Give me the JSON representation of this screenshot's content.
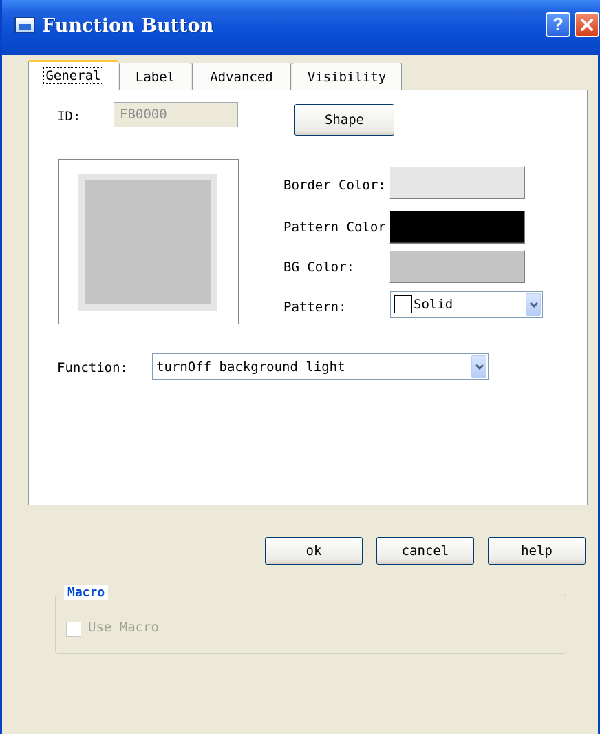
{
  "window": {
    "title": "Function Button",
    "help_label": "?",
    "close_label": "✕",
    "titlebar_color": "#0A4FD6"
  },
  "tabs": [
    {
      "label": "General",
      "active": true
    },
    {
      "label": "Label",
      "active": false
    },
    {
      "label": "Advanced",
      "active": false
    },
    {
      "label": "Visibility",
      "active": false
    }
  ],
  "general": {
    "id_label": "ID:",
    "id_value": "FB0000",
    "shape_button": "Shape",
    "border_color_label": "Border Color:",
    "border_color_value": "#E6E6E6",
    "pattern_color_label": "Pattern Color",
    "pattern_color_value": "#000000",
    "bg_color_label": "BG Color:",
    "bg_color_value": "#C4C4C4",
    "pattern_label": "Pattern:",
    "pattern_value": "Solid",
    "function_label": "Function:",
    "function_value": "turnOff background light"
  },
  "macro": {
    "group_title": "Macro",
    "use_macro_label": "Use Macro",
    "use_macro_checked": false
  },
  "footer": {
    "ok_label": "ok",
    "cancel_label": "cancel",
    "help_label": "help"
  }
}
